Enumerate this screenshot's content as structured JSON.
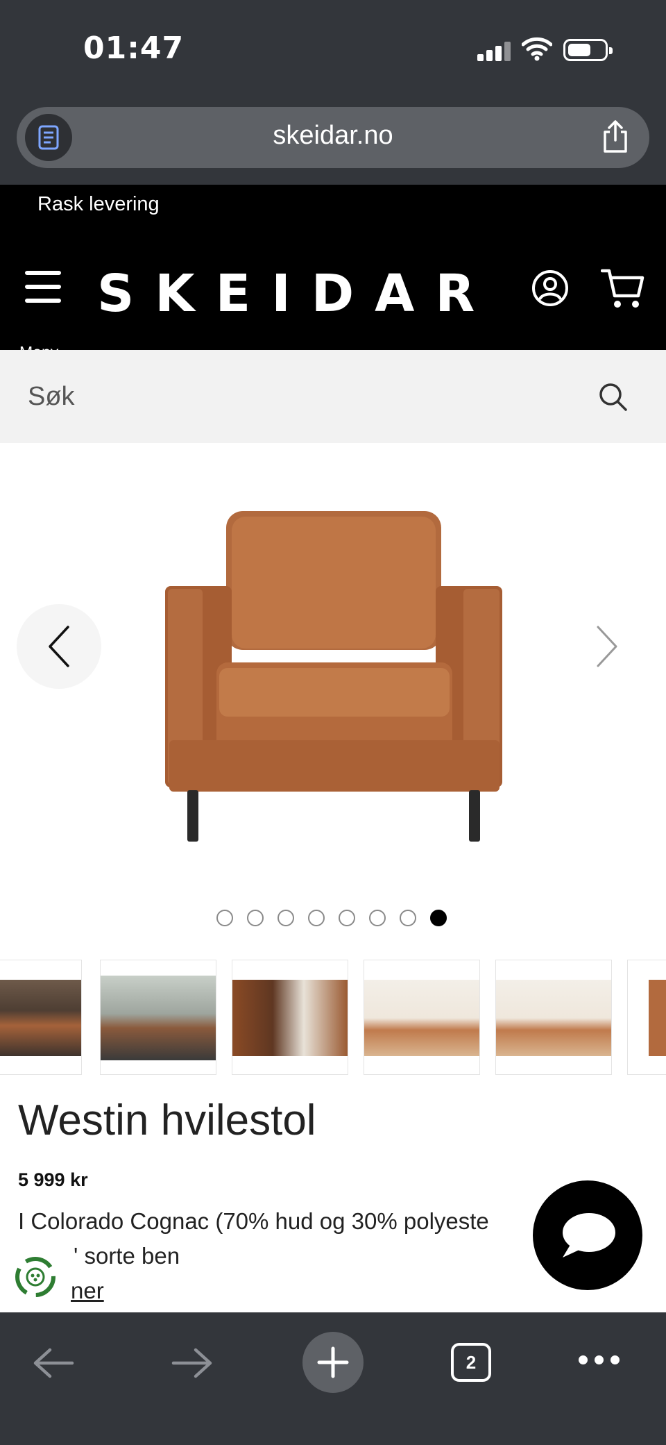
{
  "status_bar": {
    "time": "01:47"
  },
  "browser": {
    "url": "skeidar.no",
    "icons": {
      "reader": "reader-icon",
      "share": "share-icon"
    }
  },
  "promo": {
    "text": "Rask levering"
  },
  "header": {
    "menu_label": "Meny",
    "logo": "SKEIDAR",
    "icons": {
      "menu": "hamburger-icon",
      "account": "user-circle-icon",
      "cart": "cart-icon"
    }
  },
  "search": {
    "placeholder": "Søk",
    "icon": "search-icon"
  },
  "gallery": {
    "slide_count": 8,
    "active_slide": 8,
    "prev_icon": "chevron-left-icon",
    "next_icon": "chevron-right-icon"
  },
  "thumbnails": [
    {
      "name": "thumbnail-1"
    },
    {
      "name": "thumbnail-2"
    },
    {
      "name": "thumbnail-3"
    },
    {
      "name": "thumbnail-4"
    },
    {
      "name": "thumbnail-5"
    },
    {
      "name": "thumbnail-6"
    }
  ],
  "product": {
    "title": "Westin hvilestol",
    "price": "5 999 kr",
    "description_line1": "I Colorado Cognac (70% hud og 30% polyeste",
    "description_line2": "' sorte ben",
    "more_link": "ner"
  },
  "chat": {
    "icon": "chat-bubble-icon"
  },
  "toolbar": {
    "tab_count": "2",
    "icons": {
      "back": "arrow-left-icon",
      "forward": "arrow-right-icon",
      "new_tab": "plus-icon",
      "tabs": "tabs-icon",
      "more": "more-icon"
    }
  },
  "colors": {
    "chrome": "#33363b",
    "header": "#000000",
    "accent": "#000000",
    "leather": "#b06a3f"
  }
}
